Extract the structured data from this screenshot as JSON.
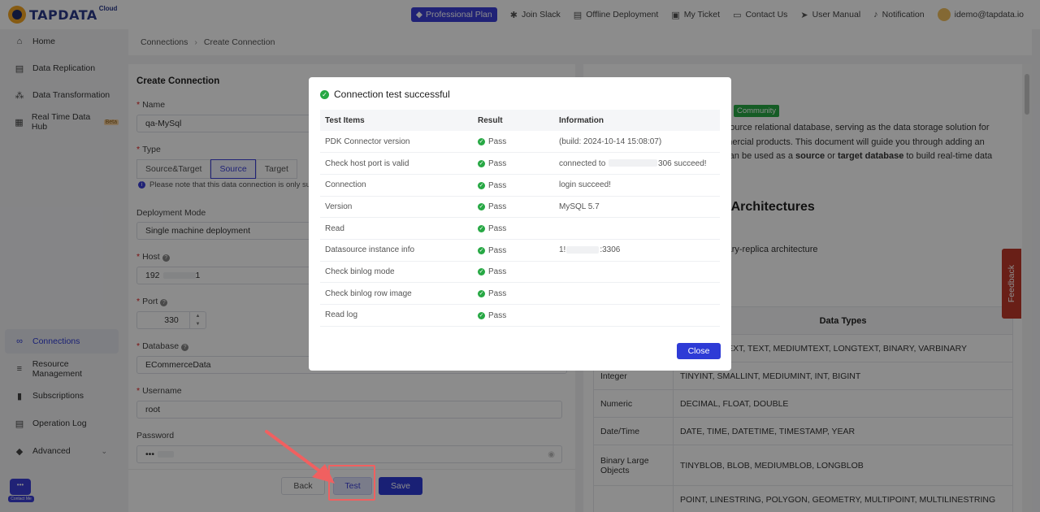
{
  "brand": {
    "name": "TAPDATA",
    "suffix": "Cloud"
  },
  "topnav": {
    "plan": "Professional Plan",
    "join_slack": "Join Slack",
    "offline_deployment": "Offline Deployment",
    "my_ticket": "My Ticket",
    "contact_us": "Contact Us",
    "user_manual": "User Manual",
    "notification": "Notification",
    "user_email": "idemo@tapdata.io"
  },
  "sidebar": {
    "items": [
      {
        "label": "Home",
        "icon": "home-icon"
      },
      {
        "label": "Data Replication",
        "icon": "replication-icon"
      },
      {
        "label": "Data Transformation",
        "icon": "transformation-icon"
      },
      {
        "label": "Real Time Data Hub",
        "icon": "datahub-icon",
        "badge": "Beta"
      },
      {
        "label": "Connections",
        "icon": "link-icon"
      },
      {
        "label": "Resource Management",
        "icon": "resource-icon"
      },
      {
        "label": "Subscriptions",
        "icon": "subscription-icon"
      },
      {
        "label": "Operation Log",
        "icon": "log-icon"
      },
      {
        "label": "Advanced",
        "icon": "advanced-icon"
      }
    ]
  },
  "breadcrumb": {
    "parent": "Connections",
    "current": "Create Connection"
  },
  "form": {
    "title": "Create Connection",
    "name_label": "Name",
    "name_value": "qa-MySql",
    "type_label": "Type",
    "type_options": [
      "Source&Target",
      "Source",
      "Target"
    ],
    "type_note": "Please note that this data connection is only suit",
    "deployment_label": "Deployment Mode",
    "deployment_value": "Single machine deployment",
    "host_label": "Host",
    "host_value": "192",
    "host_suffix": "1",
    "port_label": "Port",
    "port_value": "330",
    "database_label": "Database",
    "database_value": "ECommerceData",
    "username_label": "Username",
    "username_value": "root",
    "password_label": "Password",
    "password_value": "•••",
    "back": "Back",
    "test": "Test",
    "save": "Save"
  },
  "doc": {
    "badge": "Community",
    "line1": "n-source relational database, serving as the data storage solution for",
    "line2": "mmercial products. This document will guide you through adding an",
    "line3_a": "h can be used as a ",
    "line3_b": "source",
    "line3_c": " or ",
    "line3_d": "target database",
    "line3_e": " to build real-time data",
    "heading": "d Architectures",
    "arch": "imary-replica architecture",
    "table_header": "Data Types",
    "rows": [
      {
        "cat": "",
        "types": "HAR, TINYTEXT, TEXT, MEDIUMTEXT, LONGTEXT, BINARY, VARBINARY"
      },
      {
        "cat": "Integer",
        "types": "TINYINT, SMALLINT, MEDIUMINT, INT, BIGINT"
      },
      {
        "cat": "Numeric",
        "types": "DECIMAL, FLOAT, DOUBLE"
      },
      {
        "cat": "Date/Time",
        "types": "DATE, TIME, DATETIME, TIMESTAMP, YEAR"
      },
      {
        "cat": "Binary Large Objects",
        "types": "TINYBLOB, BLOB, MEDIUMBLOB, LONGBLOB"
      },
      {
        "cat": "",
        "types": "POINT, LINESTRING, POLYGON, GEOMETRY, MULTIPOINT, MULTILINESTRING"
      }
    ],
    "feedback": "Feedback"
  },
  "modal": {
    "title": "Connection test successful",
    "headers": [
      "Test Items",
      "Result",
      "Information"
    ],
    "rows": [
      {
        "item": "PDK Connector version",
        "result": "Pass",
        "info": "(build: 2024-10-14 15:08:07)"
      },
      {
        "item": "Check host port is valid",
        "result": "Pass",
        "info_a": "connected to",
        "info_b": "306 succeed!"
      },
      {
        "item": "Connection",
        "result": "Pass",
        "info": "login succeed!"
      },
      {
        "item": "Version",
        "result": "Pass",
        "info": "MySQL 5.7"
      },
      {
        "item": "Read",
        "result": "Pass",
        "info": ""
      },
      {
        "item": "Datasource instance info",
        "result": "Pass",
        "info_a": "1!",
        "info_b": ":3306"
      },
      {
        "item": "Check binlog mode",
        "result": "Pass",
        "info": ""
      },
      {
        "item": "Check binlog row image",
        "result": "Pass",
        "info": ""
      },
      {
        "item": "Read log",
        "result": "Pass",
        "info": ""
      }
    ],
    "close": "Close"
  },
  "contact_widget": "Contact Me",
  "colors": {
    "primary": "#2e3bd6",
    "success": "#27a844",
    "annotation": "#f06060",
    "feedback": "#c0392b"
  }
}
